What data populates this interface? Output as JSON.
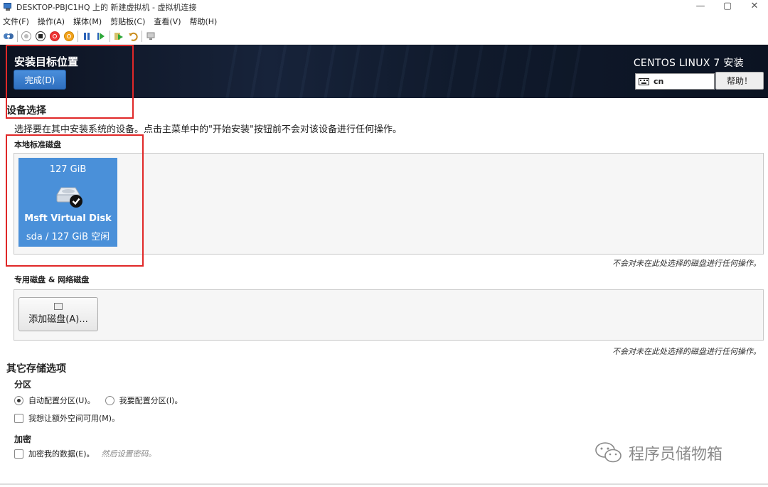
{
  "window": {
    "title": "DESKTOP-PBJC1HQ 上的 新建虚拟机 - 虚拟机连接",
    "controls": [
      "—",
      "▢",
      "✕"
    ]
  },
  "menu": [
    "文件(F)",
    "操作(A)",
    "媒体(M)",
    "剪贴板(C)",
    "查看(V)",
    "帮助(H)"
  ],
  "header": {
    "spoke_title": "安装目标位置",
    "done_label": "完成(D)",
    "product": "CENTOS LINUX 7 安装",
    "keyboard_layout": "cn",
    "help_label": "帮助！"
  },
  "device_selection": {
    "title": "设备选择",
    "description": "选择要在其中安装系统的设备。点击主菜单中的\"开始安装\"按钮前不会对该设备进行任何操作。",
    "local_disks_title": "本地标准磁盘",
    "disk": {
      "size": "127 GiB",
      "name": "Msft Virtual Disk",
      "free": "sda / 127 GiB 空闲",
      "selected": true
    },
    "local_note": "不会对未在此处选择的磁盘进行任何操作。",
    "special_title": "专用磁盘 & 网络磁盘",
    "add_disk_label": "添加磁盘(A)...",
    "special_note": "不会对未在此处选择的磁盘进行任何操作。"
  },
  "other_storage": {
    "title": "其它存储选项",
    "partition_title": "分区",
    "auto_partition": "自动配置分区(U)。",
    "manual_partition": "我要配置分区(I)。",
    "extra_space": "我想让额外空间可用(M)。",
    "encryption_title": "加密",
    "encrypt_label": "加密我的数据(E)。",
    "encrypt_hint": "然后设置密码。"
  },
  "watermark": "程序员储物箱",
  "colors": {
    "header_bg": "#101a2c",
    "accent_blue": "#4a90d9",
    "highlight_red": "#e02828"
  }
}
